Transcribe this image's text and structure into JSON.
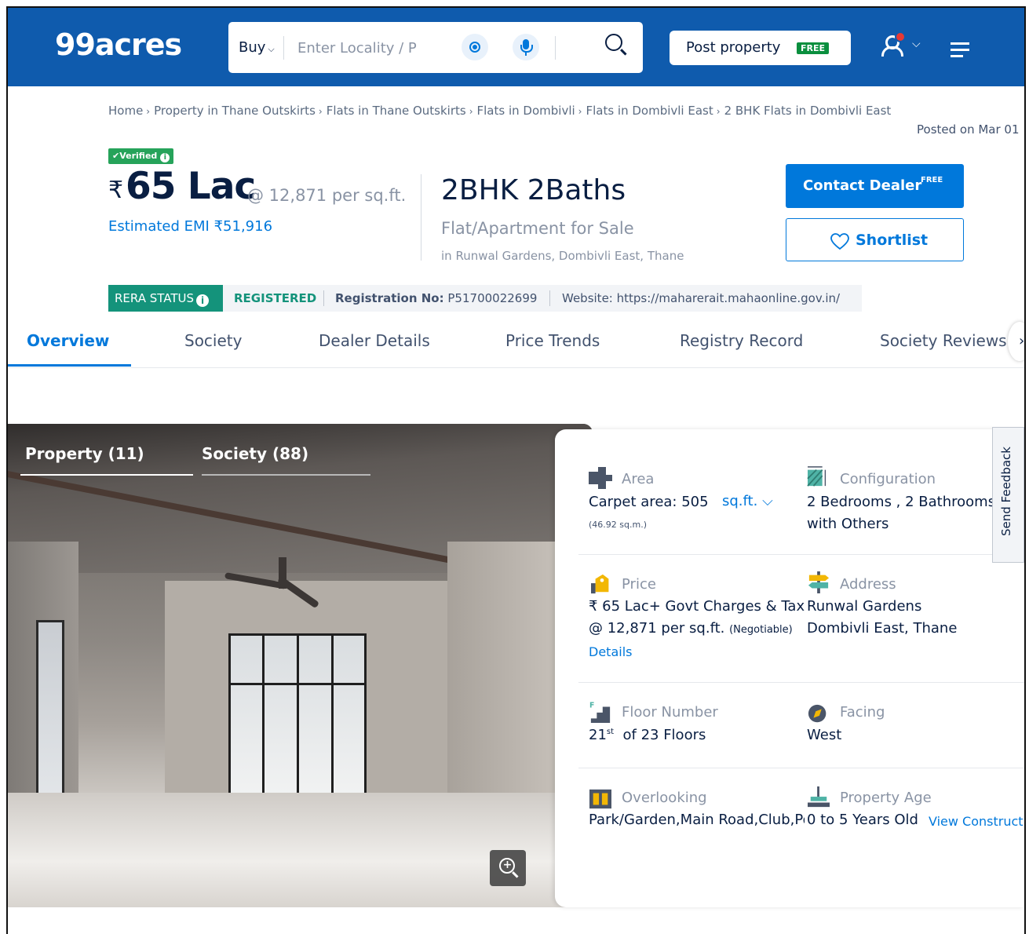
{
  "header": {
    "logo": "99acres",
    "buy_label": "Buy",
    "search_placeholder": "Enter Locality / P",
    "post_property_label": "Post property",
    "post_property_badge": "FREE"
  },
  "breadcrumb": {
    "items": [
      "Home",
      "Property in Thane Outskirts",
      "Flats in Thane Outskirts",
      "Flats in Dombivli",
      "Flats in Dombivli East",
      "2 BHK Flats in Dombivli East"
    ],
    "posted": "Posted on Mar 01"
  },
  "listing": {
    "verified": "Verified",
    "currency": "₹",
    "price": "65 Lac",
    "per_sqft": "@ 12,871 per sq.ft.",
    "emi": "Estimated EMI ₹51,916",
    "title": "2BHK 2Baths",
    "type": "Flat/Apartment for Sale",
    "location": "in Runwal Gardens, Dombivli East, Thane",
    "contact_label": "Contact Dealer",
    "contact_badge": "FREE",
    "shortlist_label": "Shortlist"
  },
  "rera": {
    "badge": "RERA STATUS",
    "status": "REGISTERED",
    "reg_label": "Registration No:",
    "reg_no": "P51700022699",
    "website": "Website: https://maharerait.mahaonline.gov.in/"
  },
  "tabs": [
    "Overview",
    "Society",
    "Dealer Details",
    "Price Trends",
    "Registry Record",
    "Society Reviews"
  ],
  "gallery": {
    "tabs": [
      "Property (11)",
      "Society (88)"
    ]
  },
  "details": {
    "area_label": "Area",
    "area_value": "Carpet area: 505",
    "area_unit": "sq.ft.",
    "area_sqm": "(46.92 sq.m.)",
    "config_label": "Configuration",
    "config_value1": "2 Bedrooms , 2 Bathrooms",
    "config_value2": "with Others",
    "price_label": "Price",
    "price_value1": "₹ 65 Lac+ Govt Charges & Tax",
    "price_value2": "@ 12,871 per sq.ft.",
    "price_negotiable": "(Negotiable)",
    "price_details_link": "Details",
    "address_label": "Address",
    "address_value1": "Runwal Gardens",
    "address_value2": "Dombivli East, Thane",
    "floor_label": "Floor Number",
    "floor_num": "21",
    "floor_sup": "st",
    "floor_of": "of 23 Floors",
    "facing_label": "Facing",
    "facing_value": "West",
    "overlooking_label": "Overlooking",
    "overlooking_value": "Park/Garden,Main Road,Club,Pool,Others",
    "age_label": "Property Age",
    "age_value": "0 to 5 Years Old",
    "age_link": "View Construction"
  },
  "feedback": "Send Feedback"
}
